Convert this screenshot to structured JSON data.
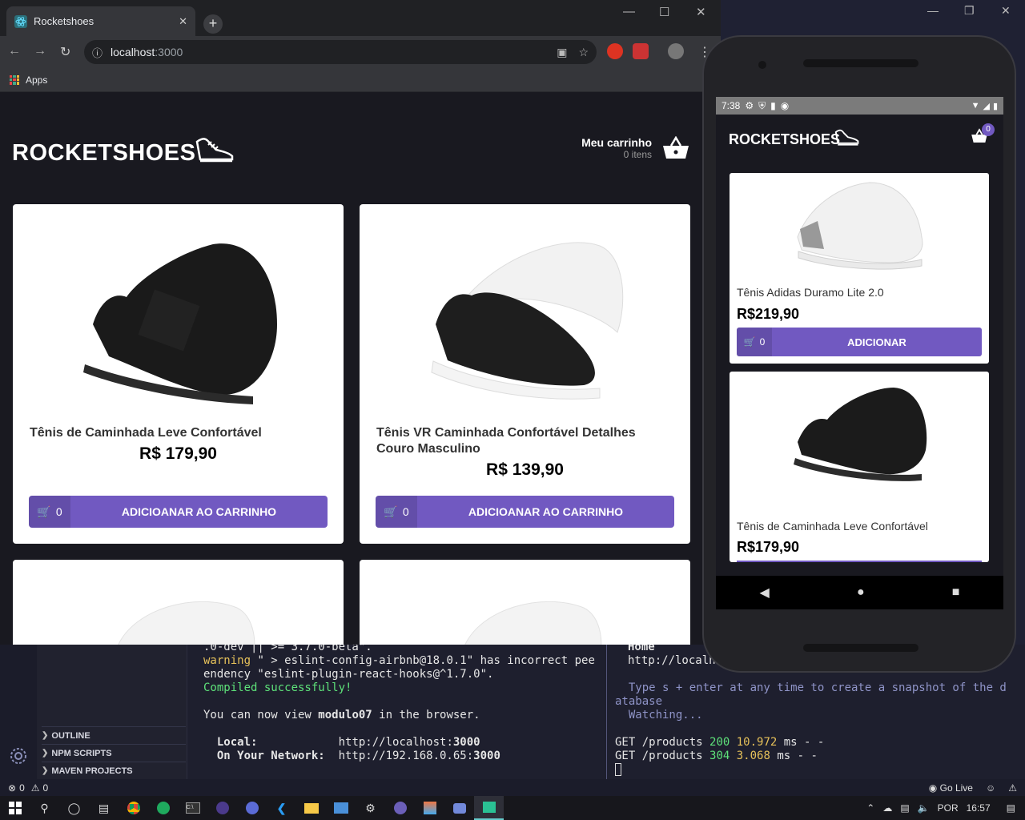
{
  "browser": {
    "tab_title": "Rocketshoes",
    "url_host": "localhost",
    "url_port": ":3000",
    "bookmarks_apps": "Apps"
  },
  "web": {
    "logo": "ROCKETSHOES",
    "cart_title": "Meu carrinho",
    "cart_count": "0 itens",
    "products": [
      {
        "title": "Tênis de Caminhada Leve Confortável",
        "price": "R$ 179,90",
        "count": "0",
        "button": "ADICIOANAR AO CARRINHO"
      },
      {
        "title": "Tênis VR Caminhada Confortável Detalhes Couro Masculino",
        "price": "R$ 139,90",
        "count": "0",
        "button": "ADICIOANAR AO CARRINHO"
      }
    ]
  },
  "phone": {
    "time": "7:38",
    "logo": "ROCKETSHOES",
    "cart_badge": "0",
    "products": [
      {
        "title": "Tênis Adidas Duramo Lite 2.0",
        "price": "R$219,90",
        "count": "0",
        "button": "ADICIONAR"
      },
      {
        "title": "Tênis de Caminhada Leve Confortável",
        "price": "R$179,90"
      }
    ]
  },
  "vscode": {
    "sections": [
      "OUTLINE",
      "NPM SCRIPTS",
      "MAVEN PROJECTS"
    ],
    "terminal_left": {
      "line1": ".0-dev || >= 3.7.0-beta\".",
      "warn_word": "warning",
      "line2_rest": " \" > eslint-config-airbnb@18.0.1\" has incorrect pee",
      "line3": "endency \"eslint-plugin-react-hooks@^1.7.0\".",
      "compiled": "Compiled successfully!",
      "view_pre": "You can now view ",
      "app_name": "modulo07",
      "view_post": " in the browser.",
      "local_label": "  Local:",
      "local_url_pre": "            http://localhost:",
      "local_port": "3000",
      "network_label": "  On Your Network:",
      "network_url_pre": "  http://192.168.0.65:",
      "network_port": "3000"
    },
    "terminal_right": {
      "home": "Home",
      "home_url": "http://localho",
      "hint1": "  Type s + enter at any time to create a snapshot of the d",
      "hint2": "atabase",
      "watching": "  Watching...",
      "req1_pre": "GET /products ",
      "req1_code": "200",
      "req1_time": " 10.972",
      "req1_post": " ms - -",
      "req2_pre": "GET /products ",
      "req2_code": "304",
      "req2_time": " 3.068",
      "req2_post": " ms - -"
    },
    "status_errors": "0",
    "status_warnings": "0",
    "go_live": "Go Live"
  },
  "taskbar": {
    "lang": "POR",
    "time": "16:57"
  },
  "colors": {
    "accent": "#7159c1",
    "page_bg": "#191920"
  }
}
